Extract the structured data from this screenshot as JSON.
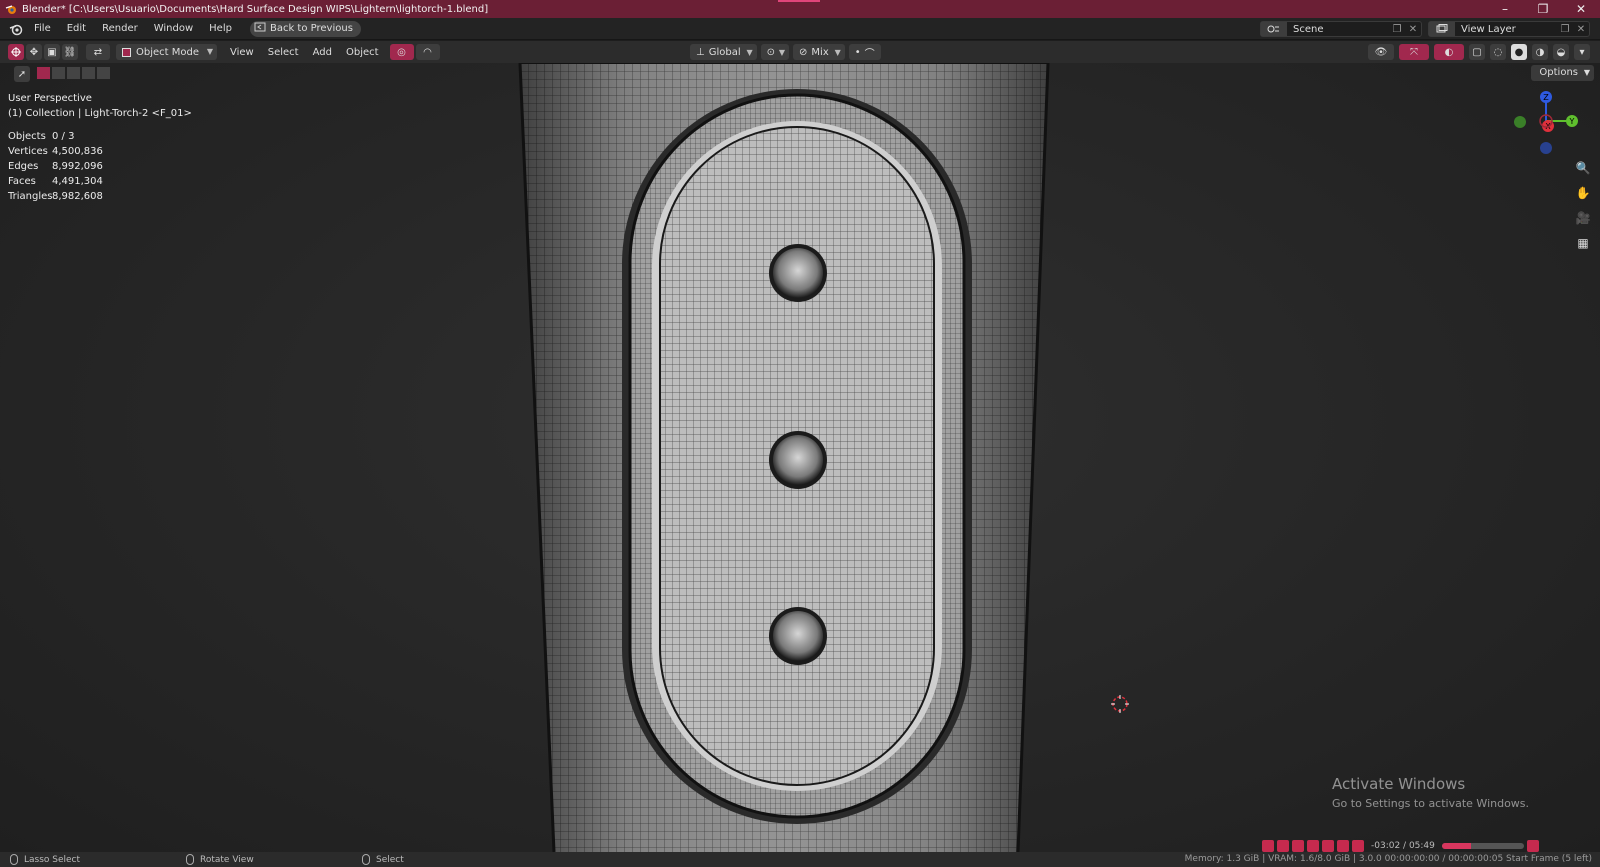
{
  "window": {
    "title": "Blender* [C:\\Users\\Usuario\\Documents\\Hard Surface Design WIPS\\Lightern\\lightorch-1.blend]",
    "controls": [
      "–",
      "❐",
      "✕"
    ]
  },
  "menubar": {
    "items": [
      "File",
      "Edit",
      "Render",
      "Window",
      "Help"
    ],
    "back_label": "Back to Previous",
    "scene_label": "Scene",
    "view_layer_label": "View Layer"
  },
  "header": {
    "mode": "Object Mode",
    "menus": [
      "View",
      "Select",
      "Add",
      "Object"
    ],
    "transform_orientation": "Global",
    "snap_mode": "Mix"
  },
  "toolrow": {
    "options_label": "Options"
  },
  "viewport": {
    "view_name": "User Perspective",
    "collection_line": "(1) Collection | Light-Torch-2 <F_01>",
    "stats": [
      {
        "label": "Objects",
        "value": "0 / 3"
      },
      {
        "label": "Vertices",
        "value": "4,500,836"
      },
      {
        "label": "Edges",
        "value": "8,992,096"
      },
      {
        "label": "Faces",
        "value": "4,491,304"
      },
      {
        "label": "Triangles",
        "value": "8,982,608"
      }
    ],
    "gizmo_axes": {
      "x": "X",
      "y": "Y",
      "z": "Z"
    },
    "watermark_title": "Activate Windows",
    "watermark_sub": "Go to Settings to activate Windows."
  },
  "statusbar": {
    "left": "Lasso Select",
    "middle": "Rotate View",
    "right": "Select",
    "info": "Memory: 1.3 GiB | VRAM: 1.6/8.0 GiB | 3.0.0   00:00:00:00 / 00:00:00:05  Start Frame (5 left)"
  },
  "timeline": {
    "time": "-03:02 / 05:49",
    "progress": 0.35
  },
  "colors": {
    "title_bar": "#6b1f35",
    "accent": "#a1284e",
    "axis_x": "#e0303c",
    "axis_y": "#5fbf2e",
    "axis_z": "#2e5ae0"
  }
}
